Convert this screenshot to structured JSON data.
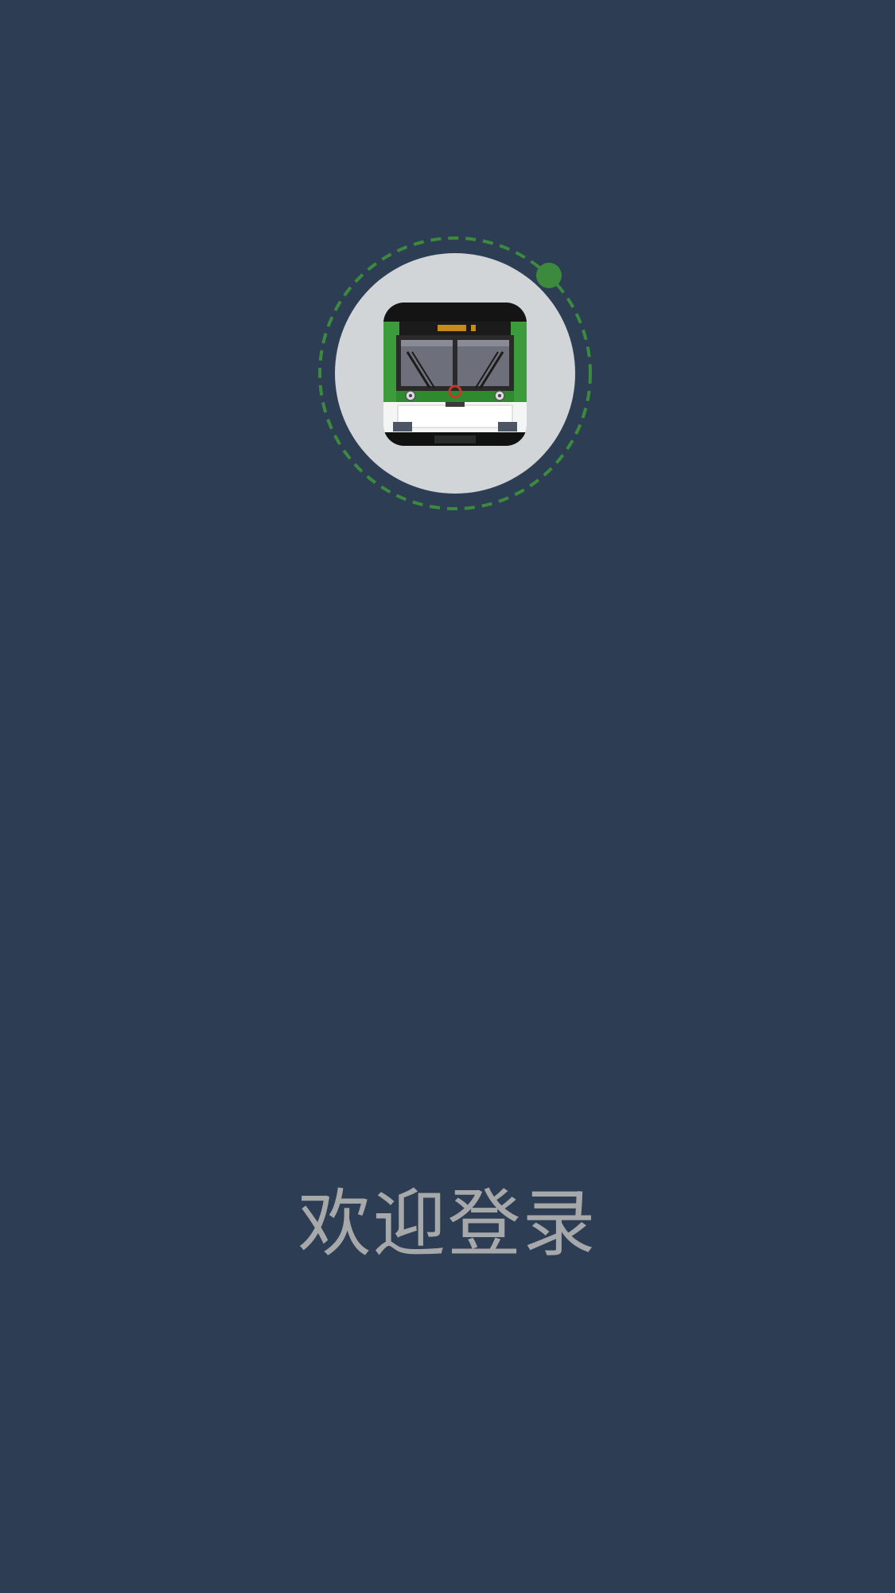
{
  "login": {
    "welcome_text": "欢迎登录"
  },
  "logo": {
    "icon": "metro-train-icon",
    "ring_color": "#3b8a3e",
    "circle_color": "#d1d5d8",
    "train_accent": "#3c9c3c"
  },
  "theme": {
    "background": "#2d3d54",
    "text": "#a6a8aa"
  }
}
